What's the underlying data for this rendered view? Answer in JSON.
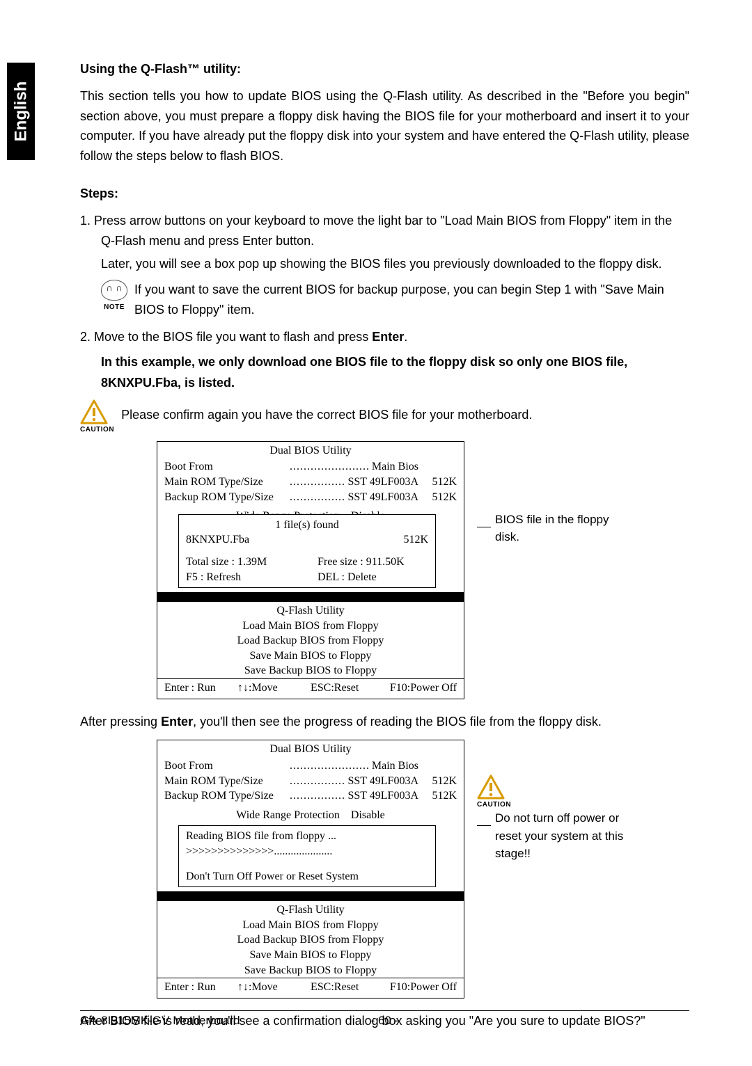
{
  "lang_tab": "English",
  "heading1": "Using the Q-Flash™ utility:",
  "intro": "This section tells you how to update BIOS using the Q-Flash utility. As described in the \"Before you begin\" section above, you must prepare a floppy disk having the BIOS file for your motherboard and insert it to your computer. If you have already put the floppy disk into your system and have entered the Q-Flash utility, please follow the steps below to flash BIOS.",
  "steps_hdr": "Steps:",
  "step1_a": "1.    Press arrow buttons on your keyboard to move the light bar to \"Load Main BIOS from Floppy\" item in the Q-Flash menu and press Enter button.",
  "step1_b": "Later, you will see a box pop up showing the BIOS files you previously downloaded to the floppy disk.",
  "note_text": "If you want to save the current BIOS for backup purpose, you can begin Step 1 with \"Save Main BIOS to Floppy\" item.",
  "note_label": "NOTE",
  "step2_a_pre": "2. Move to the BIOS file you want to flash and press ",
  "step2_a_bold": "Enter",
  "step2_a_post": ".",
  "step2_b": "In this example, we only download one BIOS file to the floppy disk so only one BIOS file, 8KNXPU.Fba, is listed.",
  "caution_label": "CAUTION",
  "caution_text": "Please confirm again you have the correct BIOS file for your motherboard.",
  "bios": {
    "title": "Dual BIOS Utility",
    "boot_from_label": "Boot From",
    "boot_from_value": "Main Bios",
    "main_rom_label": "Main ROM Type/Size",
    "main_rom_value": "SST 49LF003A",
    "main_rom_size": "512K",
    "backup_rom_label": "Backup ROM Type/Size",
    "backup_rom_value": "SST 49LF003A",
    "backup_rom_size": "512K",
    "wrp_label": "Wide Range Protection",
    "wrp_value": "Disable",
    "files_found": "1 file(s) found",
    "file_name": "8KNXPU.Fba",
    "file_size": "512K",
    "total_size": "Total size : 1.39M",
    "free_size": "Free size : 911.50K",
    "f5": "F5 : Refresh",
    "del": "DEL : Delete",
    "reading": "Reading BIOS file from floppy ...",
    "progress": ">>>>>>>>>>>>>>",
    "dont_turn": "Don't Turn Off Power or Reset System",
    "qflash": "Q-Flash Utility",
    "menu1": "Load Main BIOS from Floppy",
    "menu2": "Load Backup BIOS from Floppy",
    "menu3": "Save Main BIOS to Floppy",
    "menu4": "Save Backup BIOS to Floppy",
    "foot_enter": "Enter : Run",
    "foot_move": "↑↓:Move",
    "foot_esc": "ESC:Reset",
    "foot_f10": "F10:Power Off"
  },
  "side1": "BIOS file in the floppy disk.",
  "after1_pre": "After pressing ",
  "after1_bold": "Enter",
  "after1_post": ", you'll then see the progress of reading the BIOS file from the floppy disk.",
  "side2": "Do not turn off power or reset your system at this stage!!",
  "after2": "After BIOS file is read, you'll see a confirmation dialog box asking you \"Are you sure to update BIOS?\"",
  "footer_left": "GA-8I915MK-GV Motherboard",
  "footer_center": "- 60 -"
}
